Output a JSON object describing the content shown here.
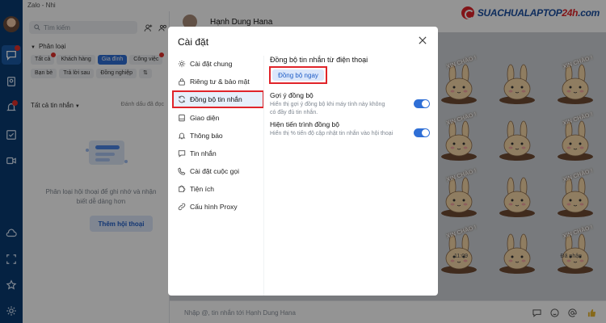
{
  "window": {
    "title": "Zalo - Nhi"
  },
  "brand": {
    "logo_text_main": "SUACHUALAPTOP",
    "logo_text_accent": "24h",
    "logo_text_tail": ".com"
  },
  "convo_panel": {
    "search_placeholder": "Tìm kiếm",
    "category_label": "Phân loại",
    "tags_row1": [
      "Tất cả",
      "Khách hàng",
      "Gia đình",
      "Công việc"
    ],
    "tags_row2": [
      "Bạn bè",
      "Trả lời sau",
      "Đồng nghiệp"
    ],
    "selected_tag": "Gia đình",
    "list_header": "Tất cả tin nhắn",
    "mark_read": "Đánh dấu đã đọc",
    "empty_text": "Phân loại hội thoại để ghi nhớ và nhận biết dễ dàng hơn",
    "add_button": "Thêm hội thoại"
  },
  "chat": {
    "contact_name": "Hạnh Dung Hana",
    "sticker_text": "XIN CHÀO !",
    "time": "11:09",
    "status": "Đã nhận",
    "composer_placeholder": "Nhập @, tin nhắn tới Hạnh Dung Hana"
  },
  "dialog": {
    "title": "Cài đặt",
    "menu": [
      {
        "label": "Cài đặt chung",
        "icon": "gear-icon"
      },
      {
        "label": "Riêng tư & bảo mật",
        "icon": "lock-icon"
      },
      {
        "label": "Đồng bộ tin nhắn",
        "icon": "sync-icon"
      },
      {
        "label": "Giao diện",
        "icon": "palette-icon"
      },
      {
        "label": "Thông báo",
        "icon": "bell-icon"
      },
      {
        "label": "Tin nhắn",
        "icon": "message-icon"
      },
      {
        "label": "Cài đặt cuộc gọi",
        "icon": "phone-icon"
      },
      {
        "label": "Tiện ích",
        "icon": "puzzle-icon"
      },
      {
        "label": "Cấu hình Proxy",
        "icon": "proxy-icon"
      }
    ],
    "active_menu": "Đồng bộ tin nhắn",
    "section_title": "Đồng bộ tin nhắn từ điện thoại",
    "sync_button": "Đồng bộ ngay",
    "options": [
      {
        "title": "Gợi ý đồng bộ",
        "desc": "Hiển thị gợi ý đồng bộ khi máy tính này không có đầy đủ tin nhắn.",
        "enabled": true
      },
      {
        "title": "Hiện tiến trình đồng bộ",
        "desc": "Hiển thị % tiến độ cập nhật tin nhắn vào hội thoại",
        "enabled": true
      }
    ]
  },
  "colors": {
    "accent": "#2f6fd6",
    "highlight": "#e0242a",
    "rail": "#0a3c73"
  }
}
